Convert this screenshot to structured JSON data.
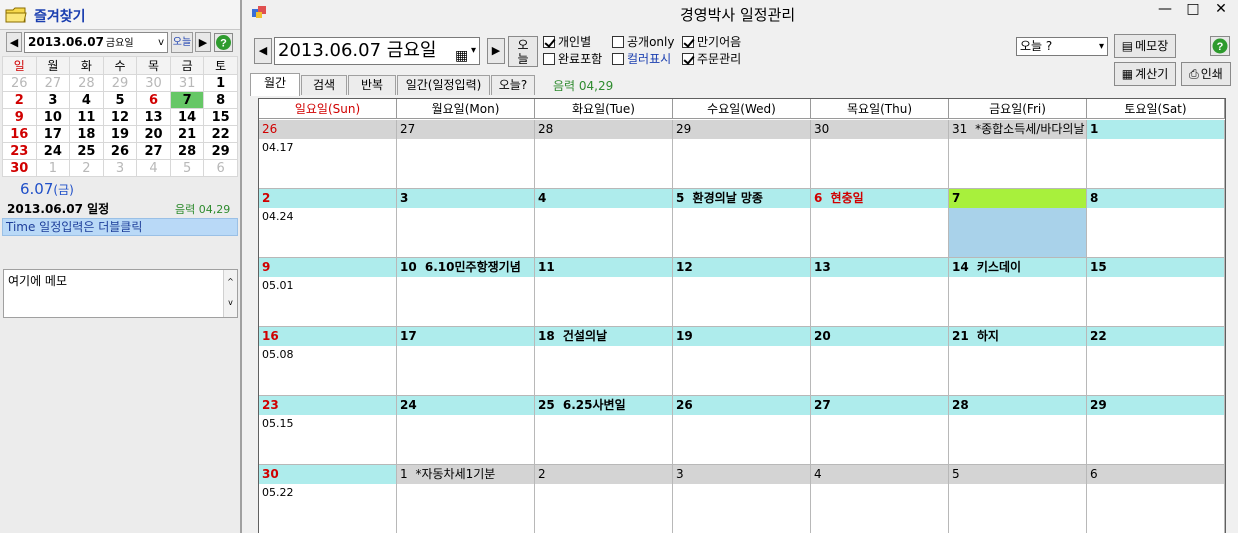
{
  "app": {
    "title": "경영박사 일정관리",
    "win_min": "—",
    "win_max": "□",
    "win_close": "✕"
  },
  "left": {
    "favorites_title": "즐겨찾기",
    "nav_prev": "◀",
    "nav_next": "▶",
    "date_value": "2013.06.07",
    "date_dow": "금요일",
    "dropdown_glyph": "v",
    "today_label": "오늘",
    "help_label": "?",
    "weekdays": [
      "일",
      "월",
      "화",
      "수",
      "목",
      "금",
      "토"
    ],
    "weeks": [
      [
        [
          "26",
          "other"
        ],
        [
          "27",
          "other"
        ],
        [
          "28",
          "other"
        ],
        [
          "29",
          "other"
        ],
        [
          "30",
          "other"
        ],
        [
          "31",
          "other"
        ],
        [
          "1",
          ""
        ]
      ],
      [
        [
          "2",
          "sun"
        ],
        [
          "3",
          ""
        ],
        [
          "4",
          ""
        ],
        [
          "5",
          ""
        ],
        [
          "6",
          "sun"
        ],
        [
          "7",
          "sel"
        ],
        [
          "8",
          ""
        ]
      ],
      [
        [
          "9",
          "sun"
        ],
        [
          "10",
          ""
        ],
        [
          "11",
          ""
        ],
        [
          "12",
          ""
        ],
        [
          "13",
          ""
        ],
        [
          "14",
          ""
        ],
        [
          "15",
          ""
        ]
      ],
      [
        [
          "16",
          "sun"
        ],
        [
          "17",
          ""
        ],
        [
          "18",
          ""
        ],
        [
          "19",
          ""
        ],
        [
          "20",
          ""
        ],
        [
          "21",
          ""
        ],
        [
          "22",
          ""
        ]
      ],
      [
        [
          "23",
          "sun"
        ],
        [
          "24",
          ""
        ],
        [
          "25",
          ""
        ],
        [
          "26",
          ""
        ],
        [
          "27",
          ""
        ],
        [
          "28",
          ""
        ],
        [
          "29",
          ""
        ]
      ],
      [
        [
          "30",
          "sun"
        ],
        [
          "1",
          "other"
        ],
        [
          "2",
          "other"
        ],
        [
          "3",
          "other"
        ],
        [
          "4",
          "other"
        ],
        [
          "5",
          "other"
        ],
        [
          "6",
          "other"
        ]
      ]
    ],
    "selected_short": "6.07",
    "selected_dow": "(금)",
    "schedule_title": "2013.06.07 일정",
    "lunar": "음력 04,29",
    "time_hint": "Time 일정입력은 더블클릭",
    "memo_text": "여기에 메모",
    "memo_up": "^",
    "memo_down": "v"
  },
  "toolbar": {
    "prev": "◀",
    "next": "▶",
    "date_value": "2013.06.07 금요일",
    "cal_glyph": "▦",
    "dropdown_glyph": "▾",
    "today_line1": "오",
    "today_line2": "늘",
    "checks": {
      "personal": {
        "label": "개인별",
        "checked": true
      },
      "public_only": {
        "label": "공개only",
        "checked": false
      },
      "due": {
        "label": "만기어음",
        "checked": true
      },
      "done": {
        "label": "완료포함",
        "checked": false
      },
      "color": {
        "label": "컬러표시",
        "checked": false
      },
      "order": {
        "label": "주문관리",
        "checked": true
      }
    },
    "select_value": "오늘 ?",
    "select_glyph": "▾",
    "memo_btn": "메모장",
    "calc_btn": "계산기",
    "print_btn": "인쇄",
    "help_label": "?"
  },
  "tabs": [
    {
      "label": "월간",
      "active": true
    },
    {
      "label": "검색",
      "active": false
    },
    {
      "label": "반복",
      "active": false
    },
    {
      "label": "일간(일정입력)",
      "active": false
    },
    {
      "label": "오늘?",
      "active": false
    }
  ],
  "lunar_top": "음력 04,29",
  "calendar": {
    "headers": [
      "일요일(Sun)",
      "월요일(Mon)",
      "화요일(Tue)",
      "수요일(Wed)",
      "목요일(Thu)",
      "금요일(Fri)",
      "토요일(Sat)"
    ],
    "weeks": [
      {
        "lunar": "04.17",
        "days": [
          {
            "n": "26",
            "text": "",
            "style": "gray",
            "red": true
          },
          {
            "n": "27",
            "text": "",
            "style": "gray"
          },
          {
            "n": "28",
            "text": "",
            "style": "gray"
          },
          {
            "n": "29",
            "text": "",
            "style": "gray"
          },
          {
            "n": "30",
            "text": "",
            "style": "gray"
          },
          {
            "n": "31",
            "text": "*종합소득세/바다의날",
            "style": "gray"
          },
          {
            "n": "1",
            "text": "",
            "style": "bold"
          }
        ]
      },
      {
        "lunar": "04.24",
        "days": [
          {
            "n": "2",
            "text": "",
            "style": "bold",
            "red": true
          },
          {
            "n": "3",
            "text": "",
            "style": "bold"
          },
          {
            "n": "4",
            "text": "",
            "style": "bold"
          },
          {
            "n": "5",
            "text": "환경의날 망종",
            "style": "bold"
          },
          {
            "n": "6",
            "text": "현충일",
            "style": "bold",
            "red": true
          },
          {
            "n": "7",
            "text": "",
            "style": "today"
          },
          {
            "n": "8",
            "text": "",
            "style": "bold"
          }
        ]
      },
      {
        "lunar": "05.01",
        "days": [
          {
            "n": "9",
            "text": "",
            "style": "bold",
            "red": true
          },
          {
            "n": "10",
            "text": "6.10민주항쟁기념",
            "style": "bold"
          },
          {
            "n": "11",
            "text": "",
            "style": "bold"
          },
          {
            "n": "12",
            "text": "",
            "style": "bold"
          },
          {
            "n": "13",
            "text": "",
            "style": "bold"
          },
          {
            "n": "14",
            "text": "키스데이",
            "style": "bold"
          },
          {
            "n": "15",
            "text": "",
            "style": "bold"
          }
        ]
      },
      {
        "lunar": "05.08",
        "days": [
          {
            "n": "16",
            "text": "",
            "style": "bold",
            "red": true
          },
          {
            "n": "17",
            "text": "",
            "style": "bold"
          },
          {
            "n": "18",
            "text": "건설의날",
            "style": "bold"
          },
          {
            "n": "19",
            "text": "",
            "style": "bold"
          },
          {
            "n": "20",
            "text": "",
            "style": "bold"
          },
          {
            "n": "21",
            "text": "하지",
            "style": "bold"
          },
          {
            "n": "22",
            "text": "",
            "style": "bold"
          }
        ]
      },
      {
        "lunar": "05.15",
        "days": [
          {
            "n": "23",
            "text": "",
            "style": "bold",
            "red": true
          },
          {
            "n": "24",
            "text": "",
            "style": "bold"
          },
          {
            "n": "25",
            "text": "6.25사변일",
            "style": "bold"
          },
          {
            "n": "26",
            "text": "",
            "style": "bold"
          },
          {
            "n": "27",
            "text": "",
            "style": "bold"
          },
          {
            "n": "28",
            "text": "",
            "style": "bold"
          },
          {
            "n": "29",
            "text": "",
            "style": "bold"
          }
        ]
      },
      {
        "lunar": "05.22",
        "days": [
          {
            "n": "30",
            "text": "",
            "style": "bold",
            "red": true
          },
          {
            "n": "1",
            "text": "*자동차세1기분",
            "style": "normal"
          },
          {
            "n": "2",
            "text": "",
            "style": "gray"
          },
          {
            "n": "3",
            "text": "",
            "style": "gray"
          },
          {
            "n": "4",
            "text": "",
            "style": "gray"
          },
          {
            "n": "5",
            "text": "",
            "style": "gray"
          },
          {
            "n": "6",
            "text": "",
            "style": "gray"
          }
        ]
      }
    ]
  }
}
